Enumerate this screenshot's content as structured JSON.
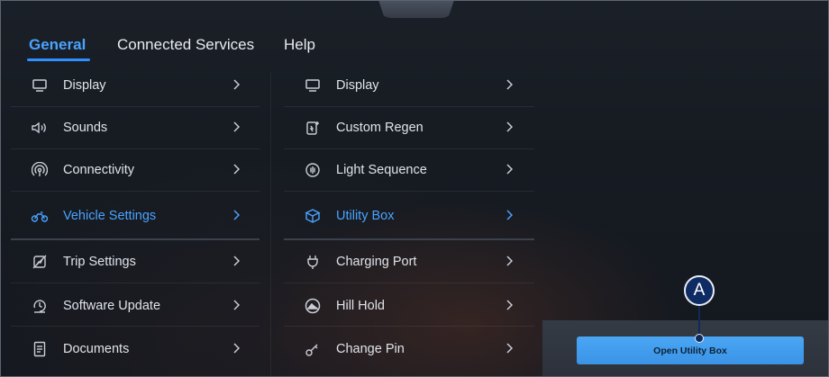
{
  "tabs": [
    {
      "label": "General"
    },
    {
      "label": "Connected Services"
    },
    {
      "label": "Help"
    }
  ],
  "left_menu": [
    {
      "label": "Display",
      "icon": "monitor-icon"
    },
    {
      "label": "Sounds",
      "icon": "speaker-icon"
    },
    {
      "label": "Connectivity",
      "icon": "connectivity-icon"
    },
    {
      "label": "Vehicle Settings",
      "icon": "vehicle-icon",
      "active": true
    },
    {
      "label": "Trip Settings",
      "icon": "trip-icon"
    },
    {
      "label": "Software Update",
      "icon": "software-update-icon"
    },
    {
      "label": "Documents",
      "icon": "document-icon"
    }
  ],
  "right_menu": [
    {
      "label": "Display",
      "icon": "monitor-icon"
    },
    {
      "label": "Custom Regen",
      "icon": "regen-icon"
    },
    {
      "label": "Light Sequence",
      "icon": "light-icon"
    },
    {
      "label": "Utility Box",
      "icon": "box-icon",
      "active": true
    },
    {
      "label": "Charging Port",
      "icon": "charging-port-icon"
    },
    {
      "label": "Hill Hold",
      "icon": "hill-hold-icon"
    },
    {
      "label": "Change Pin",
      "icon": "key-icon"
    }
  ],
  "action": {
    "button_label": "Open Utility Box"
  },
  "callout": {
    "label": "A"
  },
  "colors": {
    "accent": "#4aa3ff",
    "button": "#3f9bea",
    "callout": "#0f2b63",
    "text": "#dfe3e9"
  }
}
